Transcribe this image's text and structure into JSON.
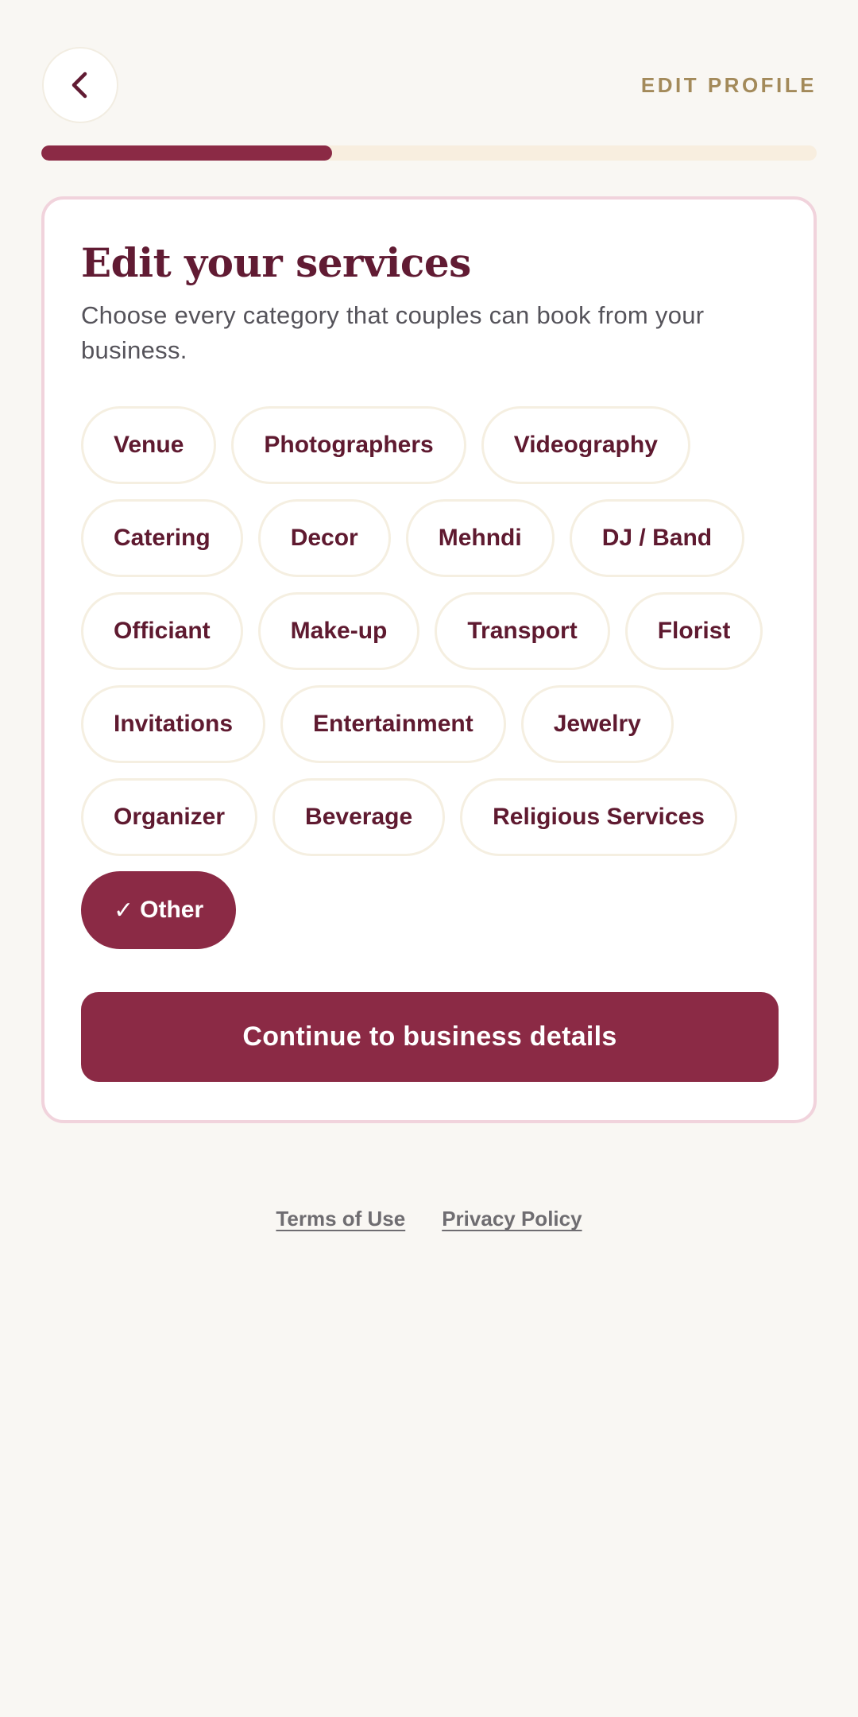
{
  "header": {
    "back_icon": "chevron-left-icon",
    "edit_profile_label": "EDIT PROFILE"
  },
  "progress": {
    "fraction": 0.375
  },
  "card": {
    "title": "Edit your services",
    "subtitle": "Choose every category that couples can book from your business.",
    "categories": [
      {
        "label": "Venue",
        "selected": false
      },
      {
        "label": "Photographers",
        "selected": false
      },
      {
        "label": "Videography",
        "selected": false
      },
      {
        "label": "Catering",
        "selected": false
      },
      {
        "label": "Decor",
        "selected": false
      },
      {
        "label": "Mehndi",
        "selected": false
      },
      {
        "label": "DJ / Band",
        "selected": false
      },
      {
        "label": "Officiant",
        "selected": false
      },
      {
        "label": "Make-up",
        "selected": false
      },
      {
        "label": "Transport",
        "selected": false
      },
      {
        "label": "Florist",
        "selected": false
      },
      {
        "label": "Invitations",
        "selected": false
      },
      {
        "label": "Entertainment",
        "selected": false
      },
      {
        "label": "Jewelry",
        "selected": false
      },
      {
        "label": "Organizer",
        "selected": false
      },
      {
        "label": "Beverage",
        "selected": false
      },
      {
        "label": "Religious Services",
        "selected": false
      },
      {
        "label": "Other",
        "selected": true
      }
    ],
    "check_mark": "✓",
    "continue_label": "Continue to business details"
  },
  "footer": {
    "terms_label": "Terms of Use",
    "privacy_label": "Privacy Policy"
  },
  "colors": {
    "accent": "#8b2a45",
    "title": "#611b33",
    "gold": "#a38a5a",
    "background": "#f9f7f3"
  }
}
